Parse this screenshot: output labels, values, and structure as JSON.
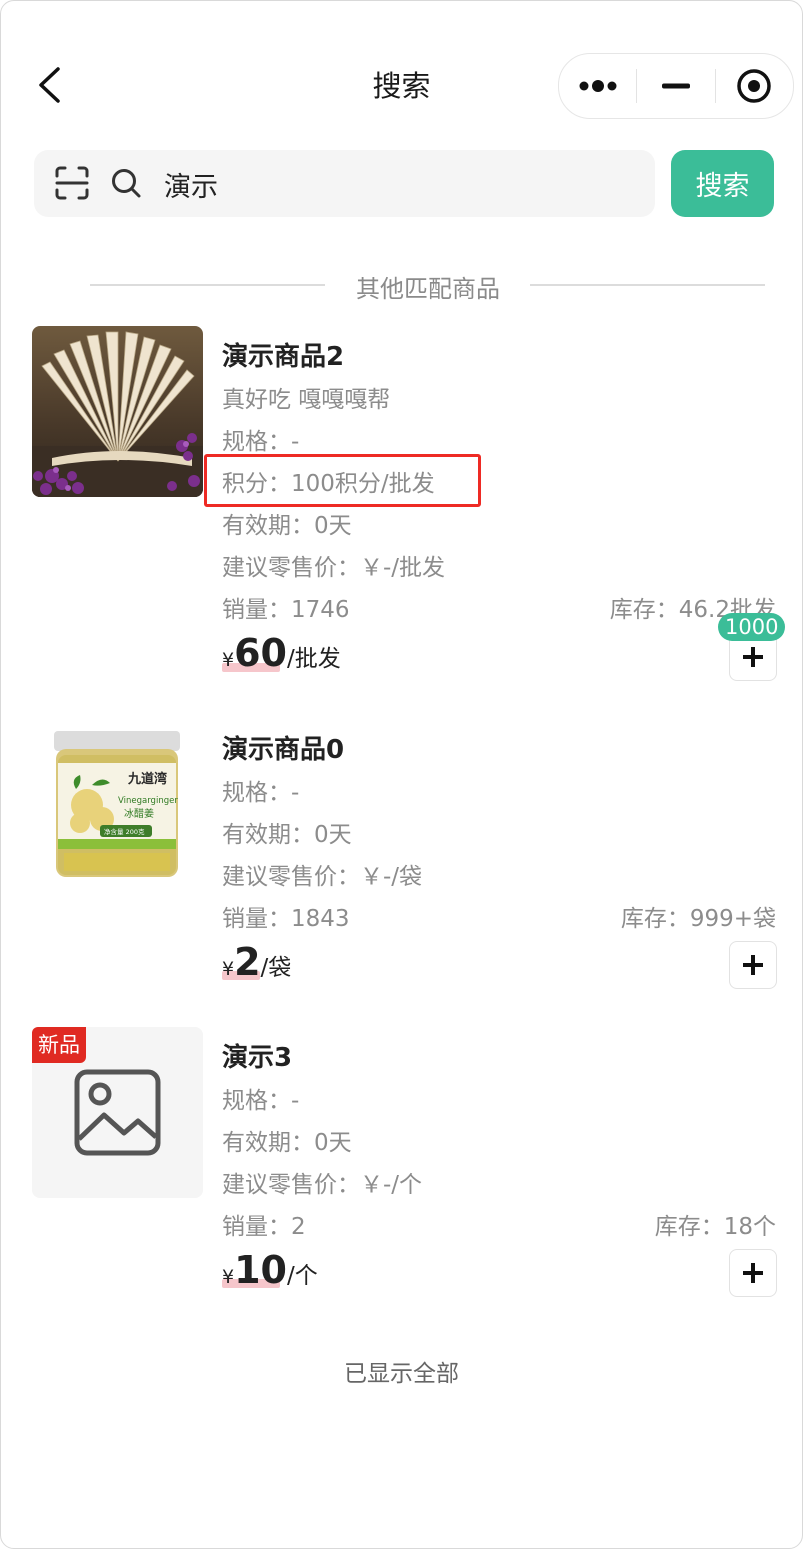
{
  "nav": {
    "title": "搜索"
  },
  "search": {
    "value": "演示",
    "button_label": "搜索"
  },
  "section": {
    "title": "其他匹配商品"
  },
  "products": [
    {
      "name": "演示商品2",
      "desc": "真好吃 嘎嘎嘎帮",
      "spec": "规格：-",
      "points": "积分：100积分/批发",
      "validity": "有效期：0天",
      "retail": "建议零售价：￥-/批发",
      "sales": "销量：1746",
      "stock": "库存：46.2批发",
      "currency": "¥",
      "price": "60",
      "unit": "/批发",
      "cart_count": "1000",
      "image": "open-book-photo"
    },
    {
      "name": "演示商品0",
      "spec": "规格：-",
      "validity": "有效期：0天",
      "retail": "建议零售价：￥-/袋",
      "sales": "销量：1843",
      "stock": "库存：999+袋",
      "currency": "¥",
      "price": "2",
      "unit": "/袋",
      "image": "ginger-jar-photo",
      "package": {
        "brand": "九道湾",
        "english": "Vinegarginger",
        "chinese": "冰醋姜",
        "weight": "净含量 200克"
      }
    },
    {
      "name": "演示3",
      "tag": "新品",
      "spec": "规格：-",
      "validity": "有效期：0天",
      "retail": "建议零售价：￥-/个",
      "sales": "销量：2",
      "stock": "库存：18个",
      "currency": "¥",
      "price": "10",
      "unit": "/个",
      "image": "image-placeholder-icon"
    }
  ],
  "footer": {
    "text": "已显示全部"
  },
  "colors": {
    "accent": "#3bbd98",
    "highlight_box": "#ee2a24",
    "new_tag": "#e02a22",
    "price_underline": "#f6c6cb"
  }
}
